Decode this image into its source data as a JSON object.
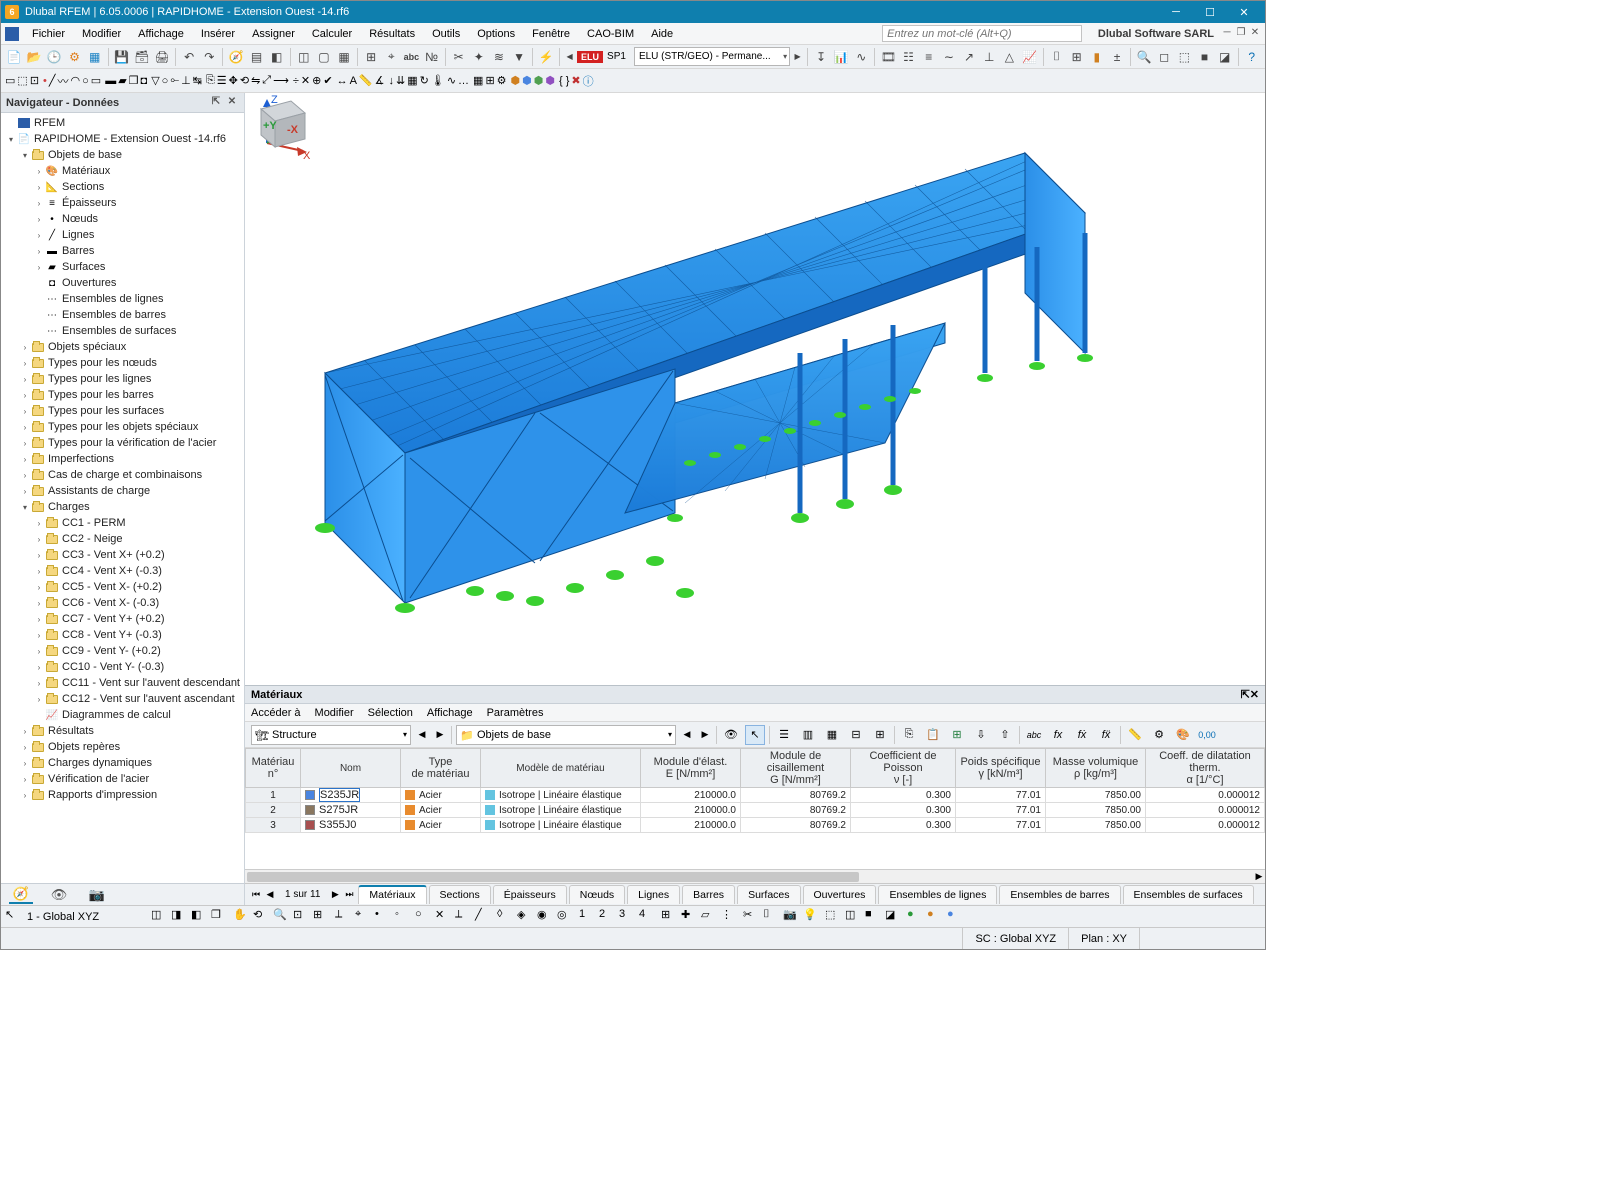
{
  "titlebar": {
    "app_icon": "6",
    "text": "Dlubal RFEM | 6.05.0006 | RAPIDHOME - Extension Ouest -14.rf6"
  },
  "menubar": {
    "items": [
      "Fichier",
      "Modifier",
      "Affichage",
      "Insérer",
      "Assigner",
      "Calculer",
      "Résultats",
      "Outils",
      "Options",
      "Fenêtre",
      "CAO-BIM",
      "Aide"
    ],
    "search_placeholder": "Entrez un mot-clé (Alt+Q)",
    "brand": "Dlubal Software SARL"
  },
  "toolbar1": {
    "elu": "ELU",
    "sp": "SP1",
    "combo": "ELU (STR/GEO) - Permane..."
  },
  "navigator": {
    "title": "Navigateur - Données",
    "root": "RFEM",
    "project": "RAPIDHOME - Extension Ouest -14.rf6",
    "base": "Objets de base",
    "base_children": [
      "Matériaux",
      "Sections",
      "Épaisseurs",
      "Nœuds",
      "Lignes",
      "Barres",
      "Surfaces",
      "Ouvertures",
      "Ensembles de lignes",
      "Ensembles de barres",
      "Ensembles de surfaces"
    ],
    "groups": [
      "Objets spéciaux",
      "Types pour les nœuds",
      "Types pour les lignes",
      "Types pour les barres",
      "Types pour les surfaces",
      "Types pour les objets spéciaux",
      "Types pour la vérification de l'acier",
      "Imperfections",
      "Cas de charge et combinaisons",
      "Assistants de charge"
    ],
    "charges": "Charges",
    "load_cases": [
      "CC1 - PERM",
      "CC2 - Neige",
      "CC3 - Vent X+ (+0.2)",
      "CC4 - Vent X+ (-0.3)",
      "CC5 - Vent X- (+0.2)",
      "CC6 - Vent X- (-0.3)",
      "CC7 - Vent Y+ (+0.2)",
      "CC8 - Vent Y+ (-0.3)",
      "CC9 - Vent Y- (+0.2)",
      "CC10 - Vent Y- (-0.3)",
      "CC11 - Vent sur l'auvent descendant",
      "CC12 - Vent sur l'auvent ascendant"
    ],
    "diag": "Diagrammes de calcul",
    "tail": [
      "Résultats",
      "Objets repères",
      "Charges dynamiques",
      "Vérification de l'acier",
      "Rapports d'impression"
    ]
  },
  "axes": {
    "x": "X",
    "y": "Y",
    "z": "Z"
  },
  "cube": {
    "py": "+Y",
    "nx": "-X"
  },
  "materials_panel": {
    "title": "Matériaux",
    "menu": [
      "Accéder à",
      "Modifier",
      "Sélection",
      "Affichage",
      "Paramètres"
    ],
    "dd1": "Structure",
    "dd2": "Objets de base",
    "headers": {
      "mat_no": "Matériau\nn°",
      "name": "Nom",
      "type": "Type\nde matériau",
      "model": "Modèle de matériau",
      "e": "Module d'élast.\nE [N/mm²]",
      "g": "Module de cisaillement\nG [N/mm²]",
      "nu": "Coefficient de Poisson\nν [-]",
      "gamma": "Poids spécifique\nγ [kN/m³]",
      "rho": "Masse volumique\nρ [kg/m³]",
      "alpha": "Coeff. de dilatation therm.\nα [1/°C]"
    },
    "rows": [
      {
        "n": "1",
        "name": "S235JR",
        "color": "#4a85e0",
        "type": "Acier",
        "model": "Isotrope | Linéaire élastique",
        "e": "210000.0",
        "g": "80769.2",
        "nu": "0.300",
        "gamma": "77.01",
        "rho": "7850.00",
        "alpha": "0.000012"
      },
      {
        "n": "2",
        "name": "S275JR",
        "color": "#8a7760",
        "type": "Acier",
        "model": "Isotrope | Linéaire élastique",
        "e": "210000.0",
        "g": "80769.2",
        "nu": "0.300",
        "gamma": "77.01",
        "rho": "7850.00",
        "alpha": "0.000012"
      },
      {
        "n": "3",
        "name": "S355J0",
        "color": "#a85050",
        "type": "Acier",
        "model": "Isotrope | Linéaire élastique",
        "e": "210000.0",
        "g": "80769.2",
        "nu": "0.300",
        "gamma": "77.01",
        "rho": "7850.00",
        "alpha": "0.000012"
      }
    ]
  },
  "tabs": {
    "page": "1 sur 11",
    "items": [
      "Matériaux",
      "Sections",
      "Épaisseurs",
      "Nœuds",
      "Lignes",
      "Barres",
      "Surfaces",
      "Ouvertures",
      "Ensembles de lignes",
      "Ensembles de barres",
      "Ensembles de surfaces"
    ]
  },
  "toolbar3": {
    "coord": "1 - Global XYZ"
  },
  "statusbar": {
    "sc": "SC : Global XYZ",
    "plan": "Plan : XY"
  }
}
